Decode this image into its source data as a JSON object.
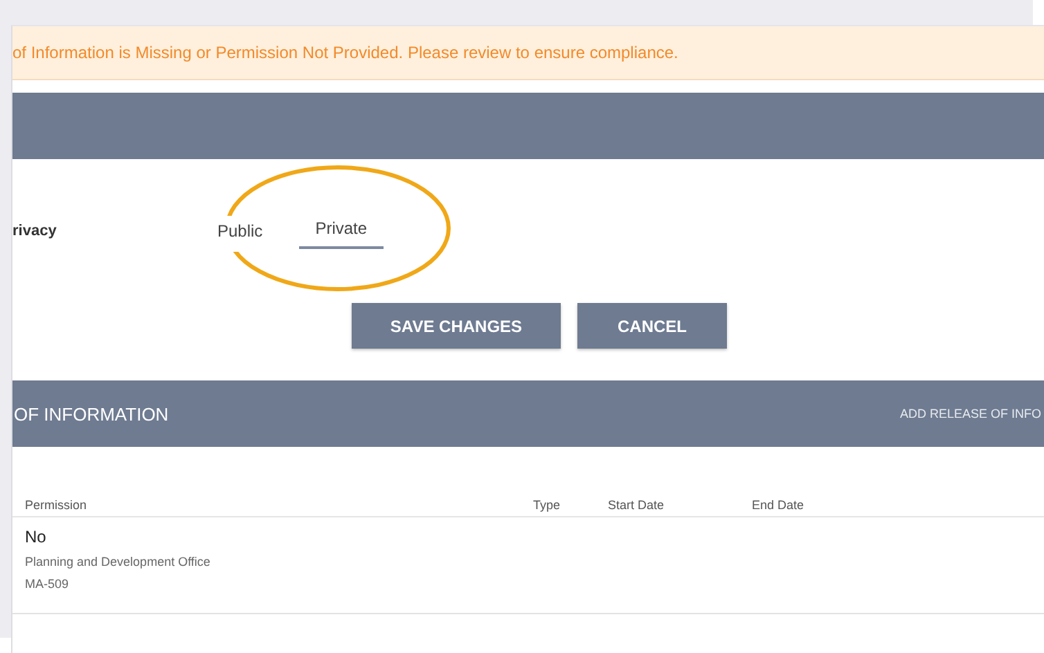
{
  "alert": {
    "text": "of Information is Missing or Permission Not Provided. Please review to ensure compliance."
  },
  "privacy": {
    "label": "rivacy",
    "options": [
      {
        "label": "Public",
        "selected": false
      },
      {
        "label": "Private",
        "selected": true
      }
    ],
    "highlighted": true
  },
  "buttons": [
    {
      "label": "SAVE CHANGES"
    },
    {
      "label": "CANCEL"
    }
  ],
  "section": {
    "title": "OF INFORMATION",
    "action": "ADD RELEASE OF INFO"
  },
  "table": {
    "columns": [
      "Permission",
      "Type",
      "Start Date",
      "End Date"
    ],
    "rows": [
      {
        "permission": "No",
        "lines": [
          "Planning and Development Office",
          "MA-509"
        ]
      }
    ]
  }
}
